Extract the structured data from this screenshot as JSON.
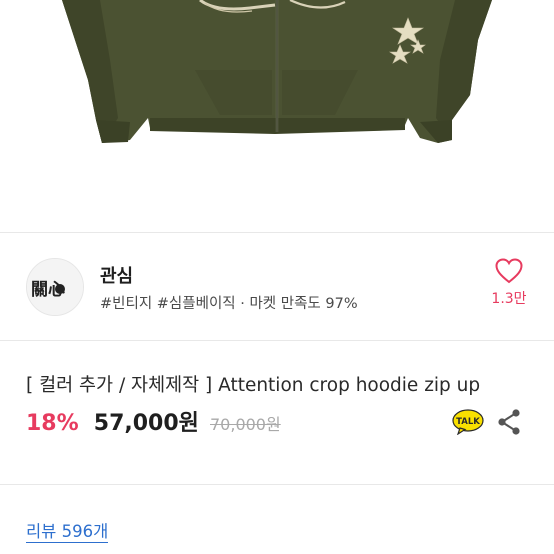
{
  "shop": {
    "name": "관심",
    "tags": "#빈티지 #심플베이직 · 마켓 만족도 97%",
    "like_count": "1.3만",
    "logo_text": "關心"
  },
  "product": {
    "title": "[ 컬러 추가 / 자체제작 ] Attention crop hoodie zip up",
    "discount": "18%",
    "price": "57,000원",
    "original_price": "70,000원",
    "talk_label": "TALK"
  },
  "reviews": {
    "link_label": "리뷰 596개"
  },
  "colors": {
    "accent": "#e73b5f",
    "hoodie": "#4b5232",
    "link": "#2d6fce",
    "kakao": "#f9e000"
  }
}
